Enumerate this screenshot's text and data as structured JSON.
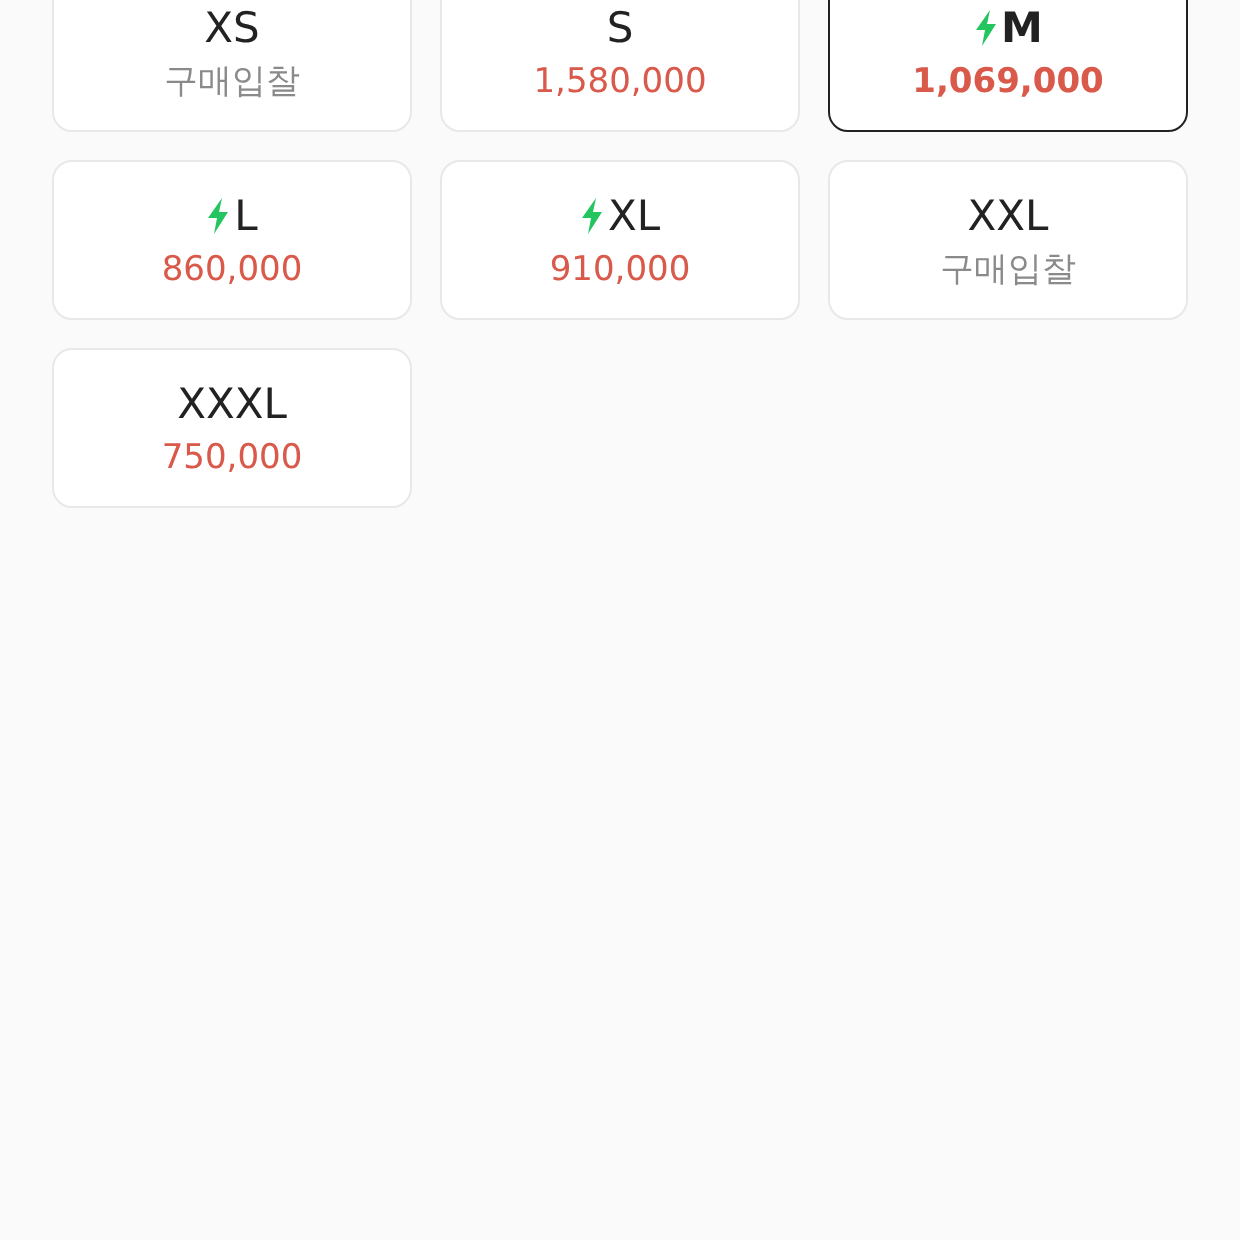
{
  "sizes": [
    {
      "size": "XS",
      "fast": false,
      "selected": false,
      "kind": "bid",
      "price": "구매입찰"
    },
    {
      "size": "S",
      "fast": false,
      "selected": false,
      "kind": "price",
      "price": "1,580,000"
    },
    {
      "size": "M",
      "fast": true,
      "selected": true,
      "kind": "price",
      "price": "1,069,000"
    },
    {
      "size": "L",
      "fast": true,
      "selected": false,
      "kind": "price",
      "price": "860,000"
    },
    {
      "size": "XL",
      "fast": true,
      "selected": false,
      "kind": "price",
      "price": "910,000"
    },
    {
      "size": "XXL",
      "fast": false,
      "selected": false,
      "kind": "bid",
      "price": "구매입찰"
    },
    {
      "size": "XXXL",
      "fast": false,
      "selected": false,
      "kind": "price",
      "price": "750,000"
    }
  ]
}
